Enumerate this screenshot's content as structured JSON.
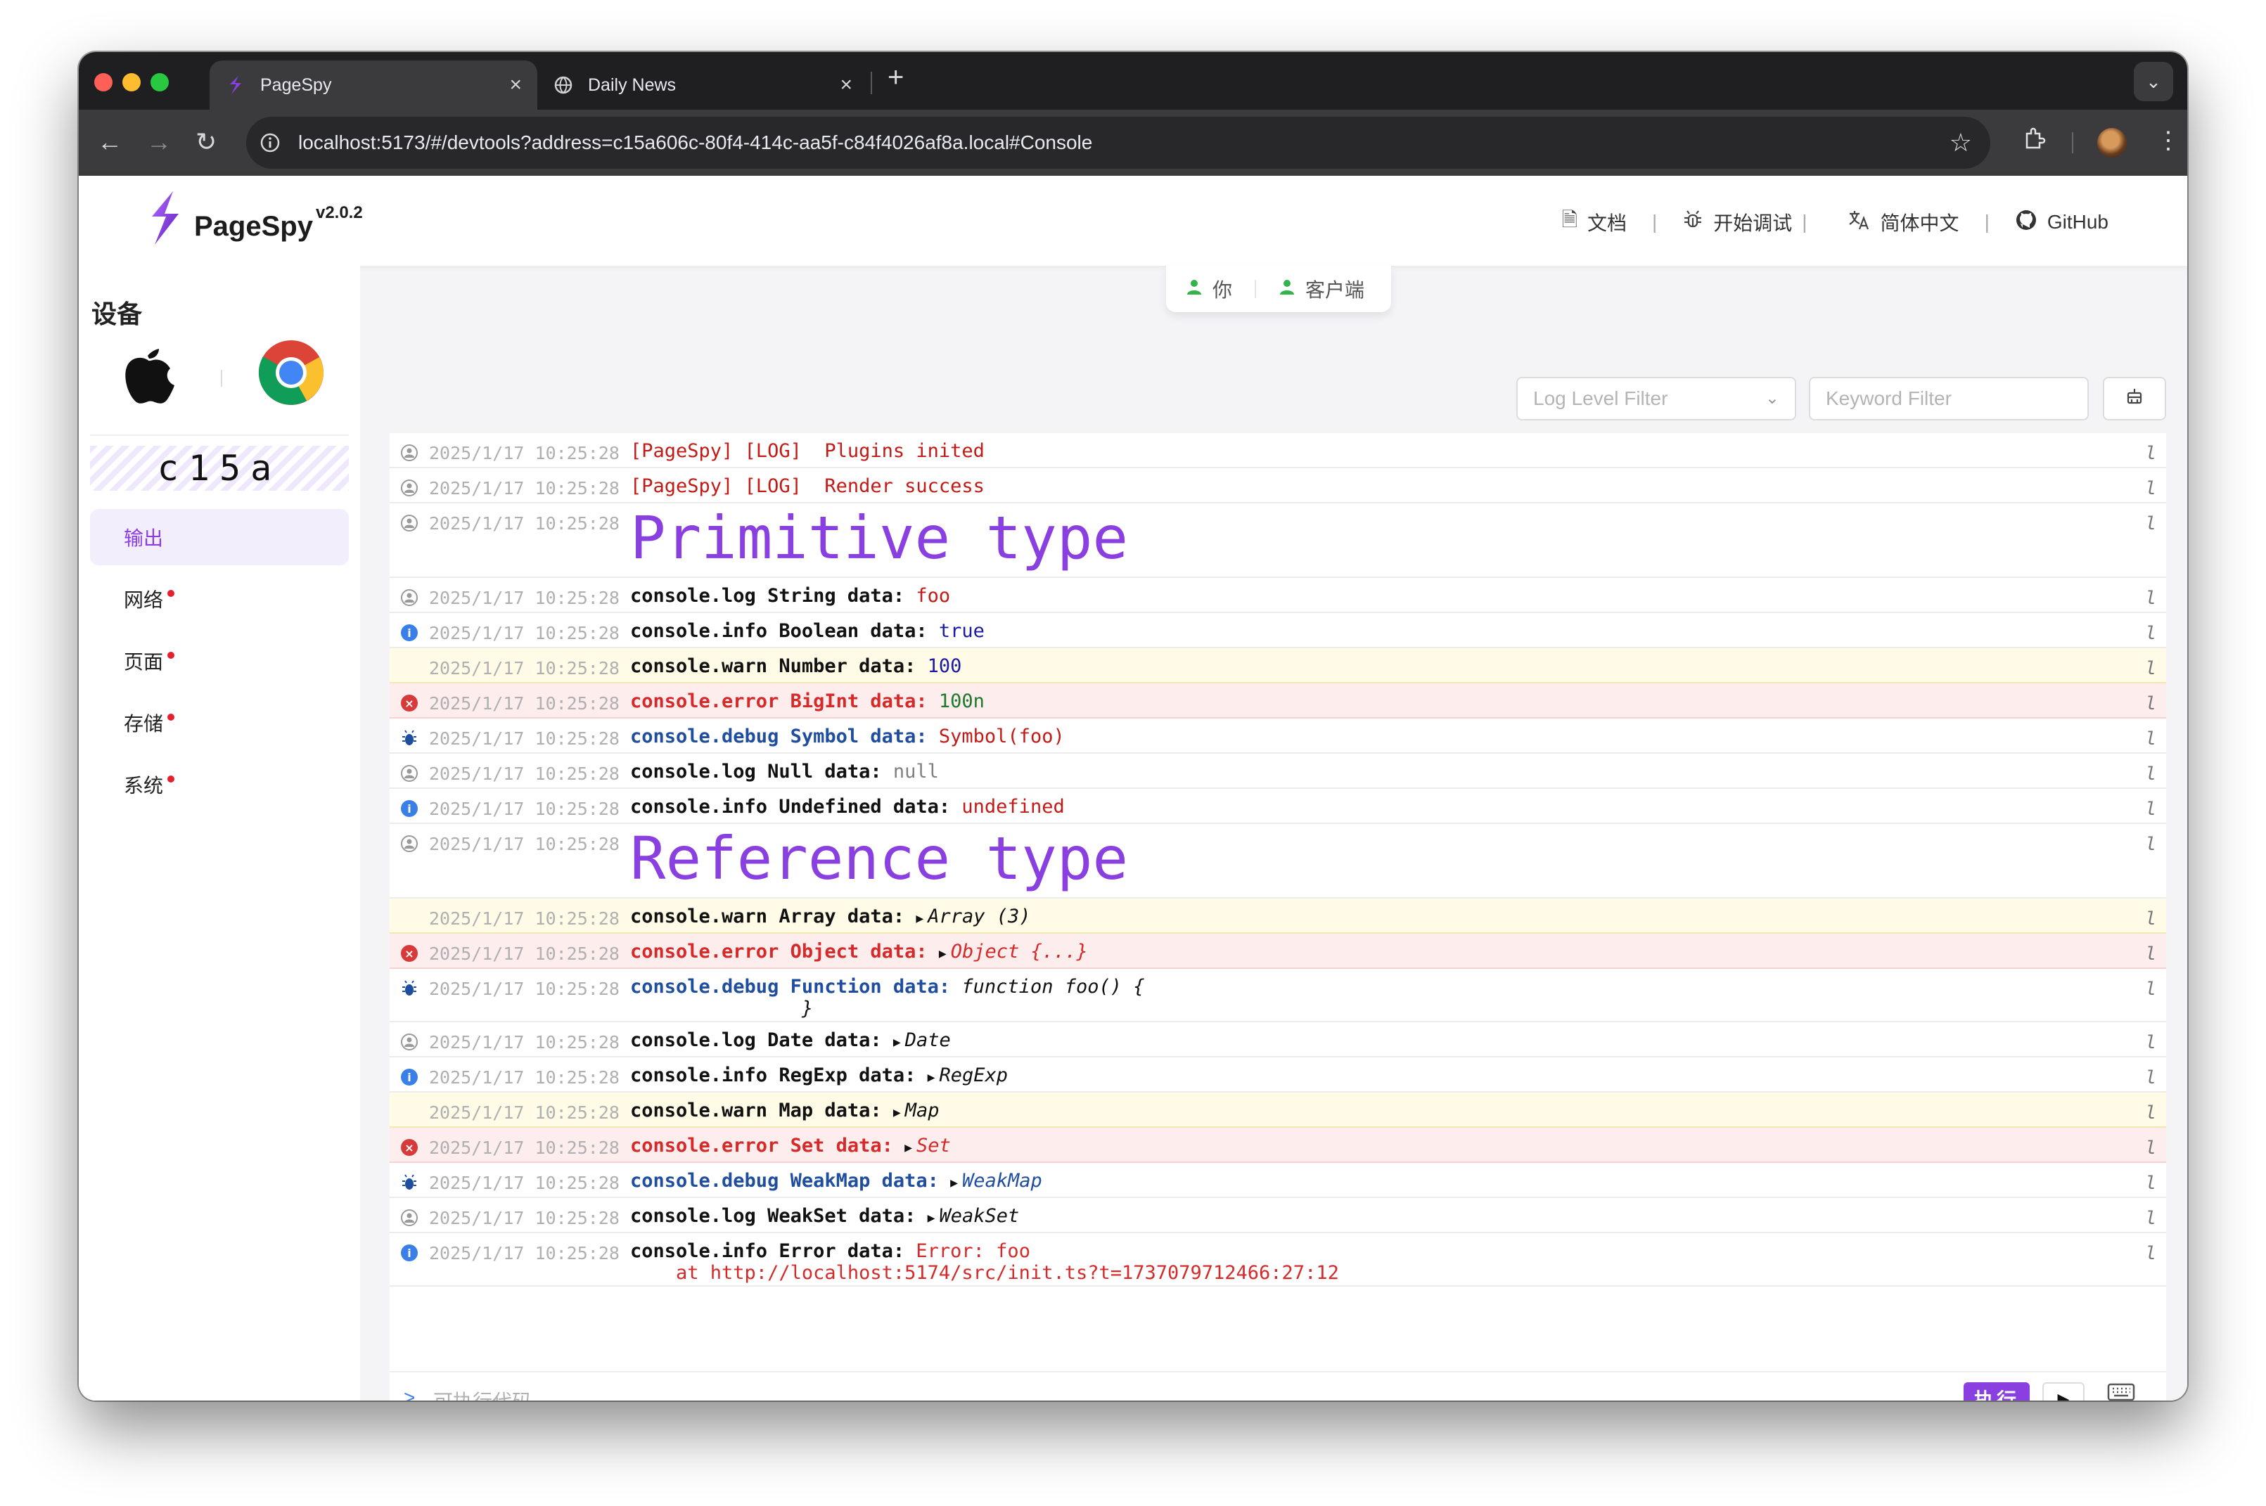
{
  "browser": {
    "tabs": [
      {
        "title": "PageSpy",
        "active": true
      },
      {
        "title": "Daily News",
        "active": false
      }
    ],
    "new_tab_label": "+",
    "url": "localhost:5173/#/devtools?address=c15a606c-80f4-414c-aa5f-c84f4026af8a.local#Console"
  },
  "header": {
    "brand": "PageSpy",
    "version": "v2.0.2",
    "nav": [
      {
        "label": "文档",
        "icon": "document-icon"
      },
      {
        "label": "开始调试",
        "icon": "bug-icon"
      },
      {
        "label": "简体中文",
        "icon": "translate-icon"
      },
      {
        "label": "GitHub",
        "icon": "github-icon"
      }
    ]
  },
  "sidebar": {
    "title": "设备",
    "device_id": "c15a",
    "menu": [
      {
        "label": "输出",
        "active": true,
        "dot": false
      },
      {
        "label": "网络",
        "active": false,
        "dot": true
      },
      {
        "label": "页面",
        "active": false,
        "dot": true
      },
      {
        "label": "存储",
        "active": false,
        "dot": true
      },
      {
        "label": "系统",
        "active": false,
        "dot": true
      }
    ]
  },
  "connection": {
    "you": "你",
    "client": "客户端"
  },
  "filters": {
    "log_level_placeholder": "Log Level Filter",
    "keyword_placeholder": "Keyword Filter"
  },
  "console": {
    "timestamp": "2025/1/17 10:25:28",
    "source_mark": "l",
    "rows": [
      {
        "level": "log",
        "segs": [
          {
            "t": "[PageSpy] [LOG]  Plugins inited",
            "c": "c-dred"
          }
        ]
      },
      {
        "level": "log",
        "segs": [
          {
            "t": "[PageSpy] [LOG]  Render success",
            "c": "c-dred"
          }
        ]
      },
      {
        "level": "log",
        "big": "Primitive type"
      },
      {
        "level": "log",
        "segs": [
          {
            "t": "console.log String data: ",
            "c": "b"
          },
          {
            "t": "foo",
            "c": "c-dred"
          }
        ]
      },
      {
        "level": "info",
        "segs": [
          {
            "t": "console.info Boolean data: ",
            "c": "b"
          },
          {
            "t": "true",
            "c": "c-num"
          }
        ]
      },
      {
        "level": "warn",
        "segs": [
          {
            "t": "console.warn Number data: ",
            "c": "b"
          },
          {
            "t": "100",
            "c": "c-num"
          }
        ]
      },
      {
        "level": "error",
        "segs": [
          {
            "t": "console.error BigInt data: ",
            "c": "b c-red"
          },
          {
            "t": "100n",
            "c": "c-big"
          }
        ]
      },
      {
        "level": "debug",
        "segs": [
          {
            "t": "console.debug Symbol data: ",
            "c": "b c-blue"
          },
          {
            "t": "Symbol(foo)",
            "c": "c-dred"
          }
        ]
      },
      {
        "level": "log",
        "segs": [
          {
            "t": "console.log Null data: ",
            "c": "b"
          },
          {
            "t": "null",
            "c": "c-gray"
          }
        ]
      },
      {
        "level": "info",
        "segs": [
          {
            "t": "console.info Undefined data: ",
            "c": "b"
          },
          {
            "t": "undefined",
            "c": "c-dred"
          }
        ]
      },
      {
        "level": "log",
        "big": "Reference type"
      },
      {
        "level": "warn",
        "segs": [
          {
            "t": "console.warn Array data: ",
            "c": "b"
          },
          {
            "t": "Array (3)",
            "c": "c-obj",
            "tri": true
          }
        ]
      },
      {
        "level": "error",
        "segs": [
          {
            "t": "console.error Object data: ",
            "c": "b c-red"
          },
          {
            "t": "Object {...}",
            "c": "c-obj c-red",
            "tri": true
          }
        ]
      },
      {
        "level": "debug",
        "segs": [
          {
            "t": "console.debug Function data: ",
            "c": "b c-blue"
          },
          {
            "t": "function foo() {\n               }",
            "c": "c-obj"
          }
        ],
        "tall": true
      },
      {
        "level": "log",
        "segs": [
          {
            "t": "console.log Date data: ",
            "c": "b"
          },
          {
            "t": "Date",
            "c": "c-obj",
            "tri": true
          }
        ]
      },
      {
        "level": "info",
        "segs": [
          {
            "t": "console.info RegExp data: ",
            "c": "b"
          },
          {
            "t": "RegExp",
            "c": "c-obj",
            "tri": true
          }
        ]
      },
      {
        "level": "warn",
        "segs": [
          {
            "t": "console.warn Map data: ",
            "c": "b"
          },
          {
            "t": "Map",
            "c": "c-obj",
            "tri": true
          }
        ]
      },
      {
        "level": "error",
        "segs": [
          {
            "t": "console.error Set data: ",
            "c": "b c-red"
          },
          {
            "t": "Set",
            "c": "c-obj c-red",
            "tri": true
          }
        ]
      },
      {
        "level": "debug",
        "segs": [
          {
            "t": "console.debug WeakMap data: ",
            "c": "b c-blue"
          },
          {
            "t": "WeakMap",
            "c": "c-obj c-blue",
            "tri": true
          }
        ]
      },
      {
        "level": "log",
        "segs": [
          {
            "t": "console.log WeakSet data: ",
            "c": "b"
          },
          {
            "t": "WeakSet",
            "c": "c-obj",
            "tri": true
          }
        ]
      },
      {
        "level": "info",
        "segs": [
          {
            "t": "console.info Error data: ",
            "c": "b"
          },
          {
            "t": "Error: foo\n    at http://localhost:5174/src/init.ts?t=1737079712466:27:12",
            "c": "c-red"
          }
        ],
        "tall": true
      }
    ]
  },
  "exec": {
    "prompt": ">",
    "placeholder": "可执行代码",
    "run_label": "执行"
  },
  "colors": {
    "accent": "#8a3fe1",
    "warn_bg": "#fffbe6",
    "error_bg": "#fdeded",
    "online": "#34b34a"
  }
}
